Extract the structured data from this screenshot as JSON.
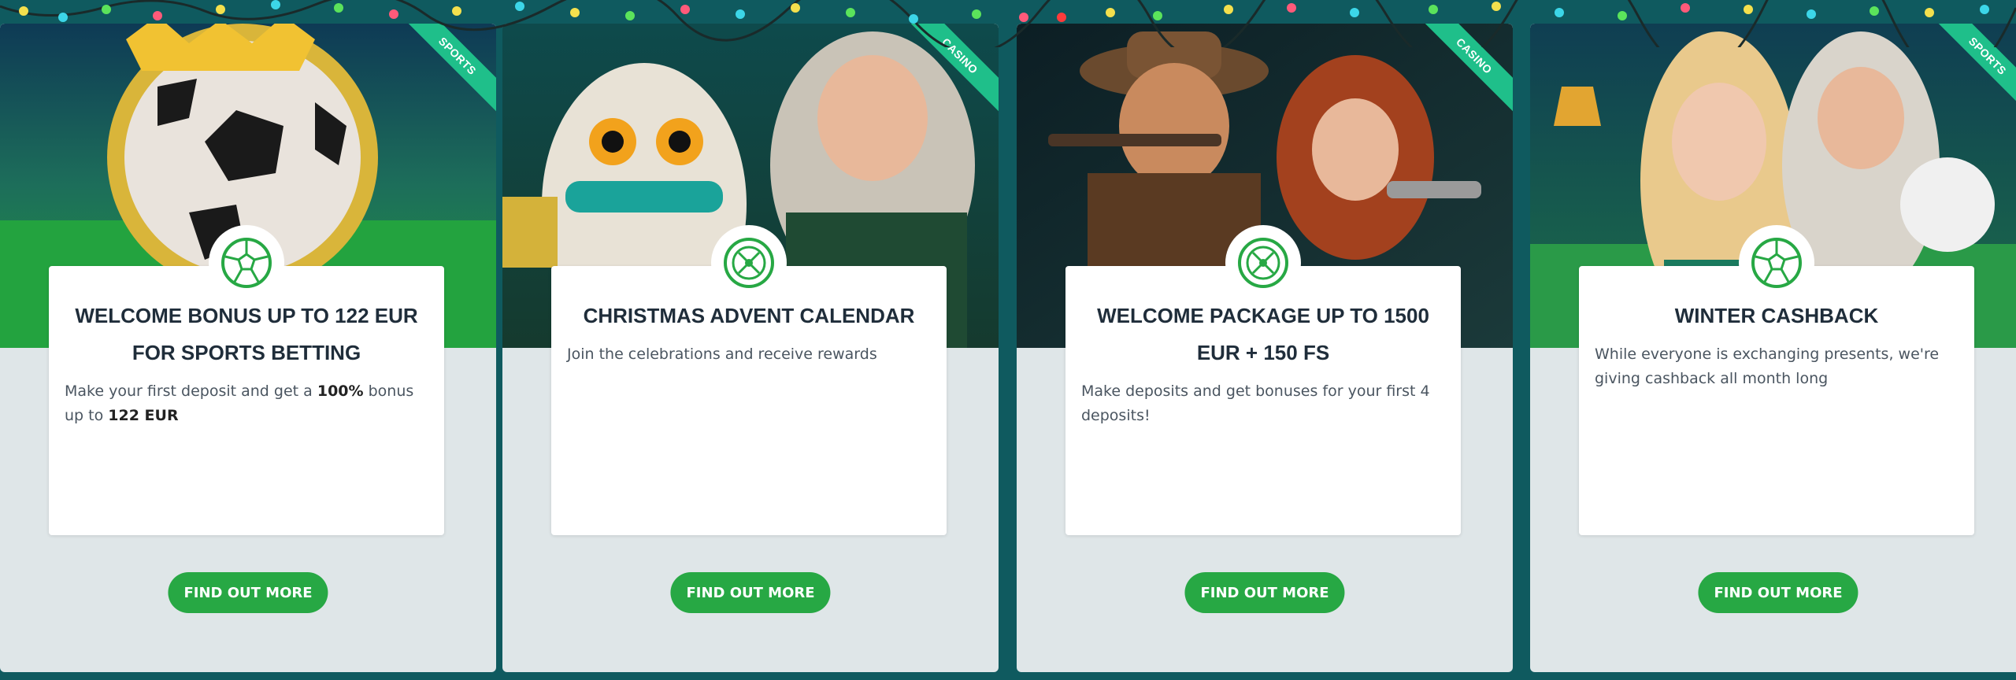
{
  "colors": {
    "accent": "#27a844",
    "ribbon": "#1fbf8a",
    "background": "#0f5a5f"
  },
  "cards": [
    {
      "ribbon": "SPORTS",
      "badge_icon": "soccer-ball-icon",
      "title": "WELCOME BONUS UP TO 122 EUR FOR SPORTS BETTING",
      "description_parts": [
        "Make your first deposit and get a ",
        "100%",
        " bonus up to ",
        "122 EUR"
      ],
      "button": "FIND OUT MORE"
    },
    {
      "ribbon": "CASINO",
      "badge_icon": "roulette-wheel-icon",
      "title": "CHRISTMAS ADVENT CALENDAR",
      "description_parts": [
        "Join the celebrations and receive rewards"
      ],
      "button": "FIND OUT MORE"
    },
    {
      "ribbon": "CASINO",
      "badge_icon": "roulette-wheel-icon",
      "title": "WELCOME PACKAGE UP TO 1500 EUR + 150 FS",
      "description_parts": [
        "Make deposits and get bonuses for your first 4 deposits!"
      ],
      "button": "FIND OUT MORE"
    },
    {
      "ribbon": "SPORTS",
      "badge_icon": "soccer-ball-icon",
      "title": "WINTER CASHBACK",
      "description_parts": [
        "While everyone is exchanging presents, we're giving cashback all month long"
      ],
      "button": "FIND OUT MORE"
    }
  ]
}
